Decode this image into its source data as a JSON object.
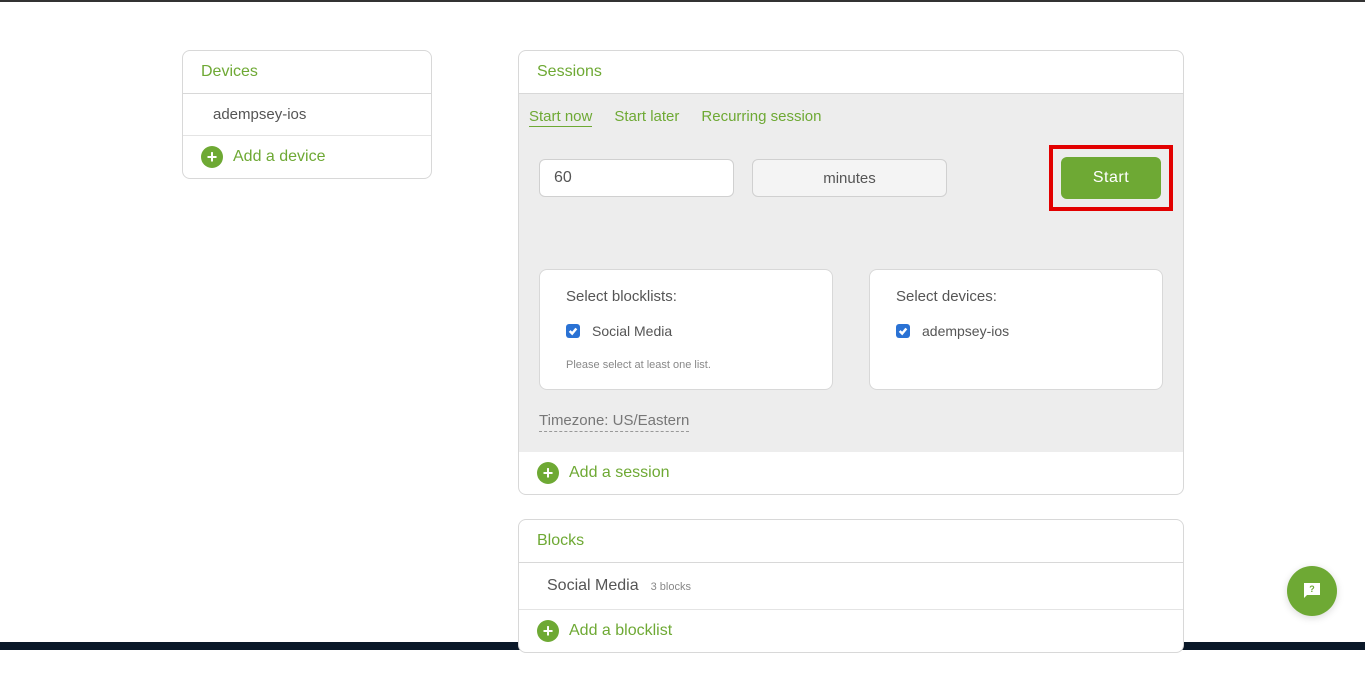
{
  "devices": {
    "title": "Devices",
    "items": [
      "adempsey-ios"
    ],
    "add_label": "Add a device"
  },
  "sessions": {
    "title": "Sessions",
    "tabs": {
      "now": "Start now",
      "later": "Start later",
      "recurring": "Recurring session"
    },
    "duration_value": "60",
    "unit_label": "minutes",
    "start_label": "Start",
    "blocklists": {
      "title": "Select blocklists:",
      "items": [
        "Social Media"
      ],
      "helper": "Please select at least one list."
    },
    "select_devices": {
      "title": "Select devices:",
      "items": [
        "adempsey-ios"
      ]
    },
    "timezone": "Timezone: US/Eastern",
    "add_label": "Add a session"
  },
  "blocks": {
    "title": "Blocks",
    "items": [
      {
        "name": "Social Media",
        "count": "3 blocks"
      }
    ],
    "add_label": "Add a blocklist"
  }
}
